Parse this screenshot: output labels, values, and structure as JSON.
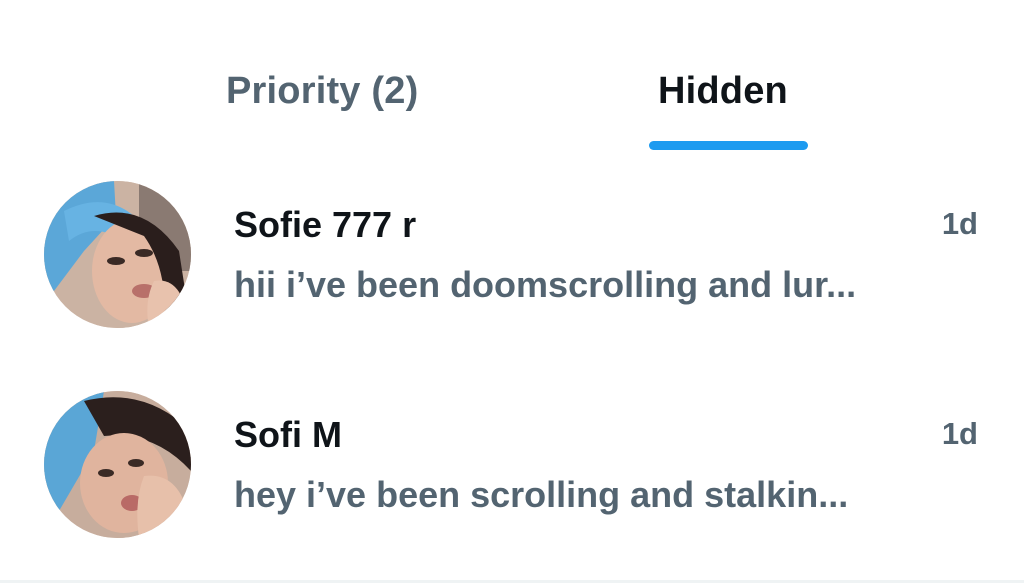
{
  "tabs": [
    {
      "label": "Priority (2)",
      "active": false
    },
    {
      "label": "Hidden",
      "active": true
    }
  ],
  "colors": {
    "accent": "#1d9bf0",
    "primary_text": "#0f1419",
    "secondary_text": "#536471"
  },
  "conversations": [
    {
      "name": "Sofie 777 r",
      "time": "1d",
      "preview": "hii i’ve been doomscrolling and lur...",
      "avatar_icon": "profile-photo"
    },
    {
      "name": "Sofi M",
      "time": "1d",
      "preview": "hey i’ve been scrolling and stalkin...",
      "avatar_icon": "profile-photo"
    }
  ]
}
